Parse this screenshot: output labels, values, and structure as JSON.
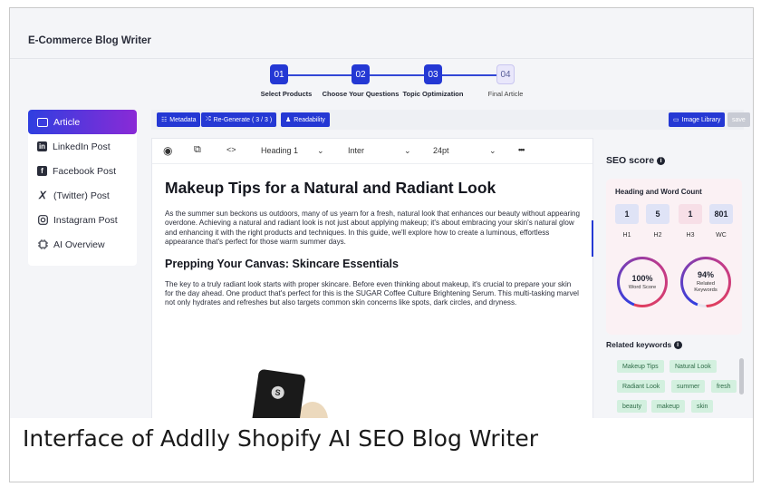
{
  "app": {
    "title": "E-Commerce Blog Writer"
  },
  "stepper": {
    "steps": [
      {
        "num": "01",
        "label": "Select Products",
        "active": true
      },
      {
        "num": "02",
        "label": "Choose Your Questions",
        "active": true
      },
      {
        "num": "03",
        "label": "Topic Optimization",
        "active": true
      },
      {
        "num": "04",
        "label": "Final Article",
        "active": false
      }
    ]
  },
  "sidebar": {
    "items": [
      {
        "label": "Article",
        "icon": "article-icon",
        "active": true
      },
      {
        "label": "LinkedIn Post",
        "icon": "linkedin-icon"
      },
      {
        "label": "Facebook Post",
        "icon": "facebook-icon"
      },
      {
        "label": "(Twitter) Post",
        "icon": "x-icon"
      },
      {
        "label": "Instagram Post",
        "icon": "instagram-icon"
      },
      {
        "label": "AI Overview",
        "icon": "ai-overview-icon"
      }
    ]
  },
  "toolbar": {
    "metadata": "Metadata",
    "regenerate": "Re-Generate ( 3 / 3 )",
    "readability": "Readability",
    "image_library": "Image Library",
    "save": "save"
  },
  "editor": {
    "heading_select": "Heading 1",
    "font_select": "Inter",
    "size_select": "24pt",
    "more": "•••",
    "title": "Makeup Tips for a Natural and Radiant Look",
    "intro": "As the summer sun beckons us outdoors, many of us yearn for a fresh, natural look that enhances our beauty without appearing overdone. Achieving a natural and radiant look is not just about applying makeup; it's about embracing your skin's natural glow and enhancing it with the right products and techniques. In this guide, we'll explore how to create a luminous, effortless appearance that's perfect for those warm summer days.",
    "subheading": "Prepping Your Canvas: Skincare Essentials",
    "body": "The key to a truly radiant look starts with proper skincare. Before even thinking about makeup, it's crucial to prepare your skin for the day ahead. One product that's perfect for this is the SUGAR Coffee Culture Brightening Serum. This multi-tasking marvel not only hydrates and refreshes but also targets common skin concerns like spots, dark circles, and dryness.",
    "product_mark": "S"
  },
  "seo": {
    "title": "SEO score",
    "heading_word_title": "Heading and Word Count",
    "stats": [
      {
        "value": "1",
        "label": "H1",
        "color": "#dfe3f6"
      },
      {
        "value": "5",
        "label": "H2",
        "color": "#dfe3f6"
      },
      {
        "value": "1",
        "label": "H3",
        "color": "#f7dfe7"
      },
      {
        "value": "801",
        "label": "WC",
        "color": "#dfe3f6"
      }
    ],
    "word_score": {
      "value": "100%",
      "label": "Word Score",
      "progress": 100
    },
    "related_score": {
      "value": "94%",
      "label": "Related Keywords",
      "progress": 94
    },
    "related_title": "Related keywords",
    "keywords": [
      "Makeup Tips",
      "Natural Look",
      "Radiant Look",
      "summer",
      "fresh",
      "beauty",
      "makeup",
      "skin"
    ]
  },
  "caption": "Interface of Addlly Shopify AI SEO Blog Writer",
  "colors": {
    "accent": "#2438d4",
    "keyword_bg": "#d3f0df",
    "gradient_end": "#8a2ad6"
  }
}
